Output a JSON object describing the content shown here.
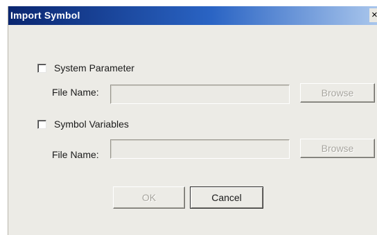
{
  "window": {
    "title": "Import Symbol",
    "close_glyph": "×"
  },
  "system_parameter": {
    "checkbox_label": "System Parameter",
    "checked": false,
    "file_name_label": "File Name:",
    "file_name_value": "",
    "browse_label": "Browse"
  },
  "symbol_variables": {
    "checkbox_label": "Symbol Variables",
    "checked": false,
    "file_name_label": "File Name:",
    "file_name_value": "",
    "browse_label": "Browse"
  },
  "buttons": {
    "ok_label": "OK",
    "cancel_label": "Cancel"
  }
}
